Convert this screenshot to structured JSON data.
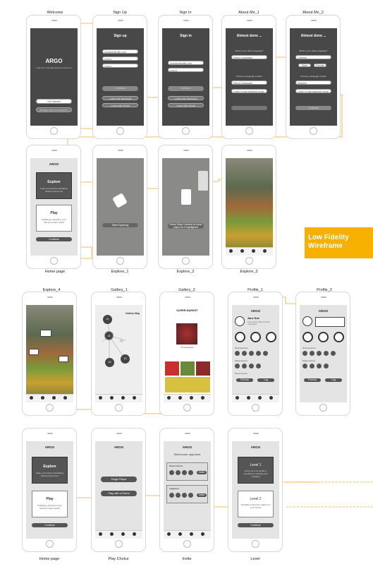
{
  "captions": {
    "welcome": "Welcome",
    "signup": "Sign Up",
    "signin": "Sign In",
    "about1": "About Me_1",
    "about2": "About Me_2",
    "home1": "Home page",
    "explore1": "Explore_1",
    "explore2": "Explore_2",
    "explore3": "Explore_3",
    "explore4": "Explore_4",
    "gallery1": "Gallery_1",
    "gallery2": "Gallery_2",
    "profile1": "Profile_1",
    "profile2": "Profile_2",
    "home2": "Home page",
    "playchoice": "Play Choice",
    "invite": "Invite",
    "level": "Level"
  },
  "badge": {
    "line1": "Low Fidelity",
    "line2": "Wireframe"
  },
  "welcome": {
    "title": "ARGO",
    "tagline": "Learn the everyday things around you",
    "get_started": "Get Started",
    "have_account": "Already have an account?"
  },
  "signup": {
    "title": "Sign up",
    "email": "johndoe@mail.com",
    "password": "••••••••",
    "confirm": "••••••••",
    "continue": "Continue",
    "facebook": "Login with facebook",
    "gmail": "Login with Gmail"
  },
  "signin": {
    "title": "Sign in",
    "email": "johndoe@mail.com",
    "password": "••••••••",
    "continue": "Continue",
    "facebook": "Login with facebook",
    "gmail": "Login with Gmail"
  },
  "about1": {
    "title": "Almost done ...",
    "q1": "What is your native language?",
    "select_lang": "Select Language",
    "q2": "Choose a language to learn",
    "select_lang2": "Select Language",
    "learn_level": "Learn in fast selected mode"
  },
  "about2": {
    "title": "Almost done ...",
    "q1": "What is your native language?",
    "lang": "Chinese",
    "opt1": "Male",
    "opt2": "Female",
    "q2": "Choose a language to learn",
    "lang2": "Spanish",
    "learn_level": "Learn in fast selected mode",
    "continue": "Continue"
  },
  "home": {
    "title": "ARGO",
    "explore": "Explore",
    "explore_desc": "Snap your food by translating objects around you",
    "play": "Play",
    "play_desc": "Challenge yourself or your friends to learn words",
    "continue": "Continue"
  },
  "explore1": {
    "tip": "Start Exploring"
  },
  "explore2": {
    "tip": "Move Snap Camera to show object as it highlighted"
  },
  "gallery1": {
    "title": "Gallery Map",
    "nodes": [
      "21",
      "16",
      "09",
      "16",
      "13"
    ]
  },
  "gallery2": {
    "title": "SUPER MARKET",
    "item": "Pomegranate"
  },
  "profile": {
    "title": "ARGO",
    "name": "Jane Doe",
    "desc": "Lorem ipsum dolor sit amet, consectetur",
    "section1": "Words Explored",
    "section2": "Badges Earned",
    "section3": "Recent Friends",
    "btn1": "Friends",
    "btn2": "Log"
  },
  "playchoice": {
    "title": "ARGO",
    "single": "Single Player",
    "friend": "Play with a Friend"
  },
  "invite": {
    "title": "ARGO",
    "heading": "Select your opponent",
    "recent": "Recent Friends",
    "suggested": "Suggested",
    "invite": "Invite"
  },
  "level": {
    "title": "ARGO",
    "l1": "Level 1",
    "l1_desc": "Come up more words in possible by matching and revisiting",
    "l2": "Level 2",
    "l2_desc": "Translate sentences made from your friends",
    "continue": "Continue"
  }
}
